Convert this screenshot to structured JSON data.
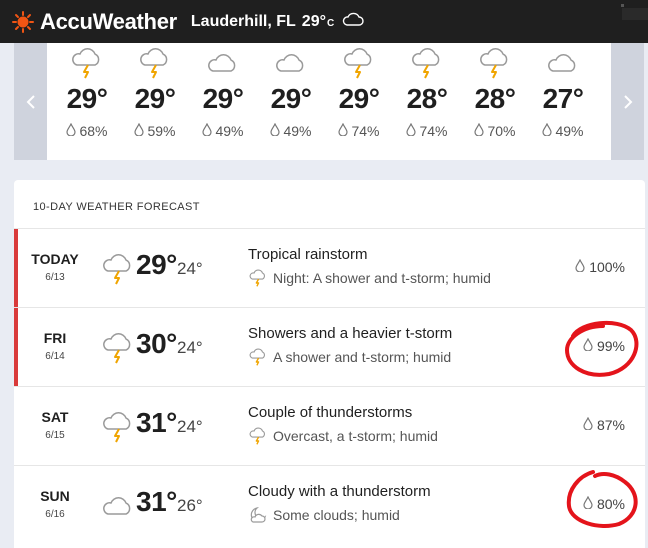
{
  "header": {
    "brand": "AccuWeather",
    "location": "Lauderhill, FL",
    "temp": "29°",
    "unit": "C",
    "brand_color": "#f05514"
  },
  "hourly": {
    "items": [
      {
        "temp": "29°",
        "precip": "68%",
        "icon": "thunderstorm-icon"
      },
      {
        "temp": "29°",
        "precip": "59%",
        "icon": "thunderstorm-icon"
      },
      {
        "temp": "29°",
        "precip": "49%",
        "icon": "cloud-icon"
      },
      {
        "temp": "29°",
        "precip": "49%",
        "icon": "cloud-icon"
      },
      {
        "temp": "29°",
        "precip": "74%",
        "icon": "thunderstorm-icon"
      },
      {
        "temp": "28°",
        "precip": "74%",
        "icon": "thunderstorm-icon"
      },
      {
        "temp": "28°",
        "precip": "70%",
        "icon": "thunderstorm-icon"
      },
      {
        "temp": "27°",
        "precip": "49%",
        "icon": "cloud-icon"
      }
    ]
  },
  "daily": {
    "title": "10-DAY WEATHER FORECAST",
    "days": [
      {
        "day": "TODAY",
        "date": "6/13",
        "hi": "29°",
        "lo": "24°",
        "phrase": "Tropical rainstorm",
        "sub": "Night: A shower and t-storm; humid",
        "precip": "100%",
        "accent": true,
        "circled": false
      },
      {
        "day": "FRI",
        "date": "6/14",
        "hi": "30°",
        "lo": "24°",
        "phrase": "Showers and a heavier t-storm",
        "sub": "A shower and t-storm; humid",
        "precip": "99%",
        "accent": true,
        "circled": true
      },
      {
        "day": "SAT",
        "date": "6/15",
        "hi": "31°",
        "lo": "24°",
        "phrase": "Couple of thunderstorms",
        "sub": "Overcast, a t-storm; humid",
        "precip": "87%",
        "accent": false,
        "circled": false
      },
      {
        "day": "SUN",
        "date": "6/16",
        "hi": "31°",
        "lo": "26°",
        "phrase": "Cloudy with a thunderstorm",
        "sub": "Some clouds; humid",
        "precip": "80%",
        "accent": false,
        "circled": true
      }
    ]
  }
}
